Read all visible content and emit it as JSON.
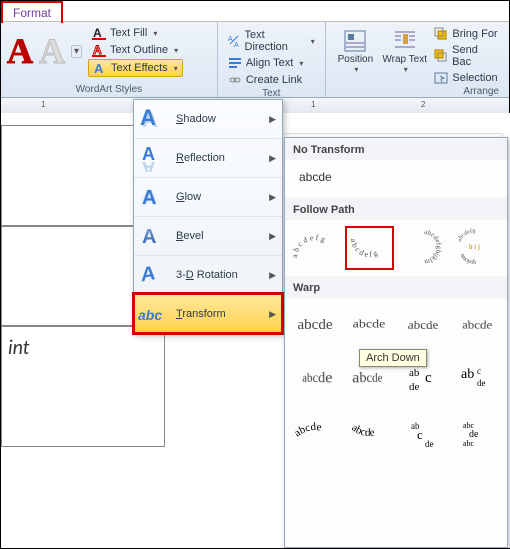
{
  "tab": {
    "format": "Format"
  },
  "ribbon": {
    "wordart": {
      "fill": "Text Fill",
      "outline": "Text Outline",
      "effects": "Text Effects",
      "group": "WordArt Styles"
    },
    "text": {
      "direction": "Text Direction",
      "align": "Align Text",
      "link": "Create Link",
      "group": "Text"
    },
    "arrange": {
      "position": "Position",
      "wrap": "Wrap Text",
      "bringfwd": "Bring For",
      "sendback": "Send Bac",
      "selection": "Selection",
      "group": "Arrange"
    }
  },
  "menu": {
    "shadow": "Shadow",
    "reflection": "Reflection",
    "glow": "Glow",
    "bevel": "Bevel",
    "rotation_pre": "3-",
    "rotation_u": "D",
    "rotation_post": " Rotation",
    "transform": "Transform"
  },
  "gallery": {
    "notransform_h": "No Transform",
    "notransform_sample": "abcde",
    "followpath_h": "Follow Path",
    "warp_h": "Warp",
    "tooltip": "Arch Down",
    "sample": "abcde",
    "sample_orig": "abcde"
  },
  "doc": {
    "text": "int"
  }
}
